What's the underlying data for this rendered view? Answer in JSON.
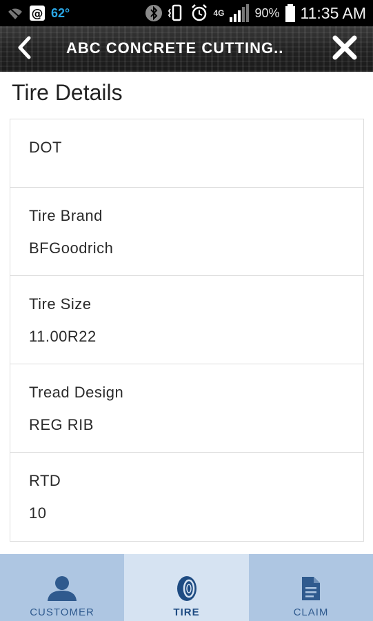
{
  "status_bar": {
    "temperature": "62°",
    "network": "4G",
    "battery_percent": "90%",
    "time": "11:35 AM"
  },
  "header": {
    "title": "ABC CONCRETE CUTTING..",
    "back_icon": "chevron-left-icon",
    "close_icon": "close-icon"
  },
  "page": {
    "title": "Tire Details"
  },
  "details": [
    {
      "label": "DOT",
      "value": ""
    },
    {
      "label": "Tire Brand",
      "value": "BFGoodrich"
    },
    {
      "label": "Tire Size",
      "value": "11.00R22"
    },
    {
      "label": "Tread Design",
      "value": "REG RIB"
    },
    {
      "label": "RTD",
      "value": "10"
    }
  ],
  "bottom_nav": {
    "tabs": [
      {
        "label": "CUSTOMER",
        "icon": "person-icon",
        "active": false
      },
      {
        "label": "TIRE",
        "icon": "tire-icon",
        "active": true
      },
      {
        "label": "CLAIM",
        "icon": "document-icon",
        "active": false
      }
    ]
  },
  "colors": {
    "nav_background": "#aec6e2",
    "nav_active_background": "#d6e3f2",
    "nav_icon": "#2f5a8e",
    "accent_temp": "#2aa7e6"
  }
}
